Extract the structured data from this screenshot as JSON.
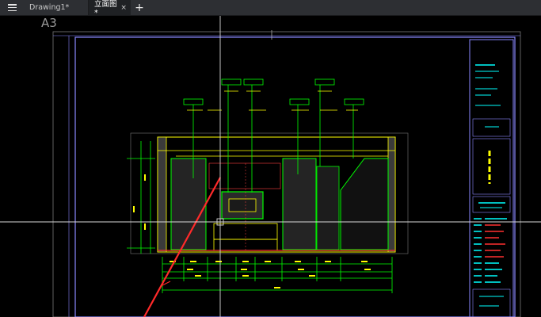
{
  "menu": {
    "icon": "hamburger-menu-icon"
  },
  "tabs": [
    {
      "label": "Drawing1*",
      "active": false
    },
    {
      "label": "立面图*",
      "active": true
    }
  ],
  "new_tab": {
    "label": "+"
  },
  "close_glyph": "×",
  "drawing": {
    "sheet_size": "A3"
  },
  "colors": {
    "tabbar": "#2d2f33",
    "active_tab": "#1f2124",
    "canvas": "#000000",
    "frame": "#8a88ff",
    "wall": "#ffff00",
    "dimension": "#00ffff",
    "annotation": "#00ff00",
    "section_line": "#ff2a2a",
    "crosshair": "#ffffff"
  }
}
